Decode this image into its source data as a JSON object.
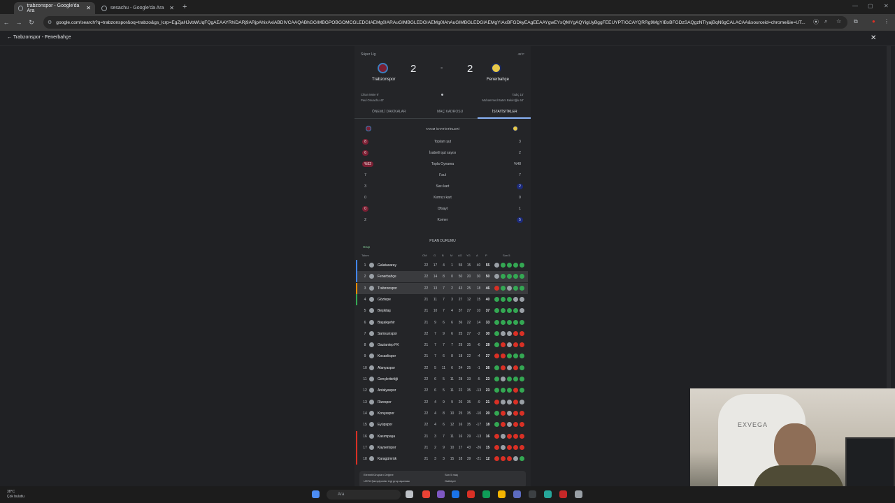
{
  "browser": {
    "tabs": [
      {
        "label": "trabzonspor - Google'da Ara"
      },
      {
        "label": "sesachu - Google'da Ara"
      }
    ],
    "url": "google.com/search?q=trabzonspor&oq=trabzo&gs_lcrp=EgZjaHJvbWUqFQgAEAAYRhiDARj9ARjpAhixAxiABDIVCAAQABhGGIMBGPOBGOMCGLEDGIAEMg0IARAuGIMBGLEDGIAEMg0IAhAuGIMBGLEDGIAEMgYIAxBFGDkyEAgEEAAYgwEYsQMYgAQYigUyBggFEEUYPTIGCAYQRRg9MgYIBxBFGDzSAQgzNTIyajBqN6gCALACAA&sourceid=chrome&ie=UT..."
  },
  "subbar": {
    "back_label": "Trabzonspor - Fenerbahçe"
  },
  "match": {
    "league": "Süper Lig",
    "weather": "45°F",
    "home": {
      "name": "Trabzonspor",
      "score": "2",
      "scorer1": "Cihan Mete 9'",
      "scorer2": "Paul Onuachu 43'"
    },
    "away": {
      "name": "Fenerbahçe",
      "score": "2",
      "scorer1": "Tadıç 15'",
      "scorer2": "Muhammed Batım Bekiroğlu 64'"
    },
    "separator": "-"
  },
  "tabs": [
    "ÖNEMLİ DAKİKALAR",
    "MAÇ KADROSU",
    "İSTATİSTİKLER"
  ],
  "stats": {
    "heading": "TAKIM İSTATİSTİKLERİ",
    "rows": [
      {
        "label": "Toplam şut",
        "home": "8",
        "away": "3"
      },
      {
        "label": "İsabetli şut sayısı",
        "home": "6",
        "away": "2"
      },
      {
        "label": "Topla Oynama",
        "home": "%52",
        "away": "%48"
      },
      {
        "label": "Faul",
        "home": "7",
        "away": "7"
      },
      {
        "label": "Sarı kart",
        "home": "3",
        "away": "2"
      },
      {
        "label": "Kırmızı kart",
        "home": "0",
        "away": "0"
      },
      {
        "label": "Ofsayt",
        "home": "0",
        "away": "1"
      },
      {
        "label": "Korner",
        "home": "2",
        "away": "5"
      }
    ]
  },
  "standings": {
    "title": "PUAN DURUMU",
    "group": "Grup",
    "headers": [
      "Takım",
      "OM",
      "G",
      "B",
      "M",
      "AG",
      "YG",
      "A",
      "P",
      "Son 5"
    ],
    "rows": [
      {
        "pos": "1",
        "team": "Galatasaray",
        "om": "22",
        "g": "17",
        "b": "4",
        "m": "1",
        "ag": "55",
        "yg": "15",
        "a": "40",
        "p": "55",
        "form": [
          "D",
          "W",
          "W",
          "W",
          "W"
        ],
        "bar": "#4285f4"
      },
      {
        "pos": "2",
        "team": "Fenerbahçe",
        "om": "22",
        "g": "14",
        "b": "8",
        "m": "0",
        "ag": "50",
        "yg": "20",
        "a": "30",
        "p": "50",
        "form": [
          "D",
          "W",
          "W",
          "W",
          "W"
        ],
        "bar": "#4285f4"
      },
      {
        "pos": "3",
        "team": "Trabzonspor",
        "om": "22",
        "g": "13",
        "b": "7",
        "m": "2",
        "ag": "43",
        "yg": "25",
        "a": "18",
        "p": "46",
        "form": [
          "L",
          "W",
          "D",
          "W",
          "W"
        ],
        "bar": "#fb8c00"
      },
      {
        "pos": "4",
        "team": "Göztepe",
        "om": "21",
        "g": "11",
        "b": "7",
        "m": "3",
        "ag": "27",
        "yg": "12",
        "a": "15",
        "p": "40",
        "form": [
          "W",
          "W",
          "W",
          "D",
          "D"
        ],
        "bar": "#34a853"
      },
      {
        "pos": "5",
        "team": "Beşiktaş",
        "om": "21",
        "g": "10",
        "b": "7",
        "m": "4",
        "ag": "37",
        "yg": "27",
        "a": "10",
        "p": "37",
        "form": [
          "W",
          "W",
          "W",
          "W",
          "D"
        ],
        "bar": ""
      },
      {
        "pos": "6",
        "team": "Başakşehir",
        "om": "21",
        "g": "9",
        "b": "6",
        "m": "6",
        "ag": "36",
        "yg": "22",
        "a": "14",
        "p": "33",
        "form": [
          "W",
          "W",
          "W",
          "W",
          "W"
        ],
        "bar": ""
      },
      {
        "pos": "7",
        "team": "Samsunspor",
        "om": "22",
        "g": "7",
        "b": "9",
        "m": "6",
        "ag": "25",
        "yg": "27",
        "a": "-2",
        "p": "30",
        "form": [
          "W",
          "D",
          "D",
          "L",
          "L"
        ],
        "bar": ""
      },
      {
        "pos": "8",
        "team": "Gaziantep FK",
        "om": "21",
        "g": "7",
        "b": "7",
        "m": "7",
        "ag": "29",
        "yg": "35",
        "a": "-6",
        "p": "28",
        "form": [
          "W",
          "L",
          "D",
          "L",
          "L"
        ],
        "bar": ""
      },
      {
        "pos": "9",
        "team": "Kocaelispor",
        "om": "21",
        "g": "7",
        "b": "6",
        "m": "8",
        "ag": "18",
        "yg": "22",
        "a": "-4",
        "p": "27",
        "form": [
          "L",
          "L",
          "W",
          "W",
          "W"
        ],
        "bar": ""
      },
      {
        "pos": "10",
        "team": "Alanyaspor",
        "om": "22",
        "g": "5",
        "b": "11",
        "m": "6",
        "ag": "24",
        "yg": "25",
        "a": "-1",
        "p": "26",
        "form": [
          "W",
          "L",
          "D",
          "L",
          "W"
        ],
        "bar": ""
      },
      {
        "pos": "11",
        "team": "Gençlerbirliği",
        "om": "22",
        "g": "6",
        "b": "5",
        "m": "11",
        "ag": "28",
        "yg": "33",
        "a": "-5",
        "p": "23",
        "form": [
          "W",
          "D",
          "W",
          "W",
          "W"
        ],
        "bar": ""
      },
      {
        "pos": "12",
        "team": "Antalyaspor",
        "om": "22",
        "g": "6",
        "b": "5",
        "m": "11",
        "ag": "22",
        "yg": "35",
        "a": "-13",
        "p": "23",
        "form": [
          "W",
          "W",
          "W",
          "L",
          "W"
        ],
        "bar": ""
      },
      {
        "pos": "13",
        "team": "Rizespor",
        "om": "22",
        "g": "4",
        "b": "9",
        "m": "9",
        "ag": "26",
        "yg": "35",
        "a": "-9",
        "p": "21",
        "form": [
          "L",
          "D",
          "D",
          "L",
          "D"
        ],
        "bar": ""
      },
      {
        "pos": "14",
        "team": "Konyaspor",
        "om": "22",
        "g": "4",
        "b": "8",
        "m": "10",
        "ag": "25",
        "yg": "35",
        "a": "-10",
        "p": "20",
        "form": [
          "W",
          "L",
          "D",
          "L",
          "L"
        ],
        "bar": ""
      },
      {
        "pos": "15",
        "team": "Eyüpspor",
        "om": "22",
        "g": "4",
        "b": "6",
        "m": "12",
        "ag": "16",
        "yg": "35",
        "a": "-17",
        "p": "18",
        "form": [
          "W",
          "L",
          "D",
          "L",
          "L"
        ],
        "bar": ""
      },
      {
        "pos": "16",
        "team": "Kasımpaşa",
        "om": "21",
        "g": "3",
        "b": "7",
        "m": "11",
        "ag": "16",
        "yg": "29",
        "a": "-13",
        "p": "16",
        "form": [
          "L",
          "D",
          "L",
          "L",
          "L"
        ],
        "bar": "#d93025"
      },
      {
        "pos": "17",
        "team": "Kayserispor",
        "om": "21",
        "g": "2",
        "b": "9",
        "m": "10",
        "ag": "17",
        "yg": "43",
        "a": "-26",
        "p": "15",
        "form": [
          "L",
          "D",
          "L",
          "L",
          "L"
        ],
        "bar": "#d93025"
      },
      {
        "pos": "18",
        "team": "Karagümrük",
        "om": "21",
        "g": "3",
        "b": "3",
        "m": "15",
        "ag": "18",
        "yg": "39",
        "a": "-21",
        "p": "12",
        "form": [
          "L",
          "L",
          "L",
          "D",
          "W"
        ],
        "bar": "#d93025"
      }
    ],
    "footer_left_title": "Elemeli/Grupları Değme",
    "footer_left_item": "UEFA Şampiyonlar Ligi grup aşaması",
    "footer_right_title": "Son 5 maç",
    "footer_right_item": "Galibiyet"
  },
  "taskbar": {
    "temp": "38°C",
    "weather": "Çok bulutlu",
    "search_placeholder": "Ara"
  },
  "webcam": {
    "chair_logo": "EXVEGA"
  }
}
